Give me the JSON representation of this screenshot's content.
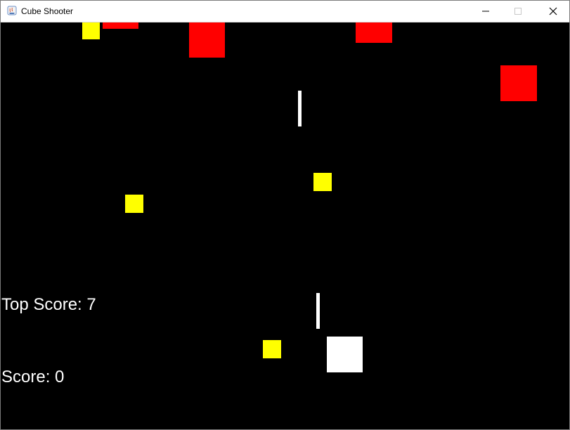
{
  "window": {
    "title": "Cube Shooter",
    "controls": {
      "minimize_icon": "minimize-icon",
      "maximize_icon": "maximize-icon",
      "close_icon": "close-icon"
    }
  },
  "game": {
    "background_color": "#000000",
    "enemy_color": "#ff0000",
    "pickup_color": "#ffff00",
    "player_color": "#ffffff",
    "bullet_color": "#ffffff"
  },
  "hud": {
    "top_score_label": "Top Score: 7",
    "score_label": "Score: 0"
  }
}
